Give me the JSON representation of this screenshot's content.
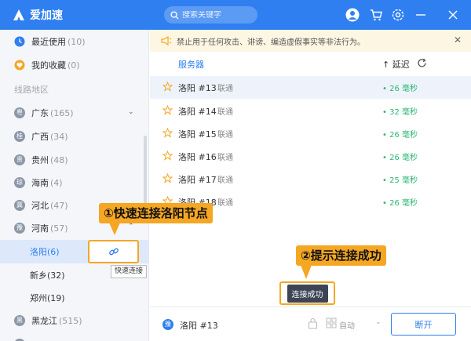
{
  "app": {
    "name": "爱加速",
    "search_placeholder": "搜索关键字"
  },
  "sidebar": {
    "top_items": [
      {
        "label": "最近使用",
        "count": "(10)",
        "icon": "clock-icon"
      },
      {
        "label": "我的收藏",
        "count": "(0)",
        "icon": "heart-icon"
      }
    ],
    "section_label": "线路地区",
    "regions": [
      {
        "label": "广东",
        "count": "(165)",
        "icon_char": "粤"
      },
      {
        "label": "广西",
        "count": "(34)",
        "icon_char": "桂"
      },
      {
        "label": "贵州",
        "count": "(48)",
        "icon_char": "贵"
      },
      {
        "label": "海南",
        "count": "(4)",
        "icon_char": "琼"
      },
      {
        "label": "河北",
        "count": "(47)",
        "icon_char": "冀"
      },
      {
        "label": "河南",
        "count": "(57)",
        "icon_char": "豫"
      }
    ],
    "subregions": [
      {
        "label": "洛阳",
        "count": "(6)"
      },
      {
        "label": "新乡",
        "count": "(32)"
      },
      {
        "label": "郑州",
        "count": "(19)"
      }
    ],
    "after_regions": [
      {
        "label": "黑龙江",
        "count": "(515)",
        "icon_char": "黑"
      }
    ],
    "connect_tooltip": "快速连接"
  },
  "notice": {
    "text": "禁止用于任何攻击、诽谤、编造虚假事实等非法行为。"
  },
  "list": {
    "header_server": "服务器",
    "header_latency": "↑ 延迟",
    "rows": [
      {
        "name": "洛阳 #13",
        "isp": "联通",
        "latency": "• 26 毫秒"
      },
      {
        "name": "洛阳 #14",
        "isp": "联通",
        "latency": "• 32 毫秒"
      },
      {
        "name": "洛阳 #15",
        "isp": "联通",
        "latency": "• 26 毫秒"
      },
      {
        "name": "洛阳 #16",
        "isp": "联通",
        "latency": "• 26 毫秒"
      },
      {
        "name": "洛阳 #17",
        "isp": "联通",
        "latency": "• 25 毫秒"
      },
      {
        "name": "洛阳 #18",
        "isp": "联通",
        "latency": "• 26 毫秒"
      }
    ]
  },
  "annotations": {
    "step1": "①快速连接洛阳节点",
    "step2": "②提示连接成功",
    "toast": "连接成功"
  },
  "bottom_bar": {
    "province_icon_char": "豫",
    "current_node": "洛阳 #13",
    "mode": "自动",
    "disconnect": "断开"
  },
  "colors": {
    "brand": "#2f7ff0",
    "callout": "#f5a623",
    "latency_good": "#2bb673"
  }
}
